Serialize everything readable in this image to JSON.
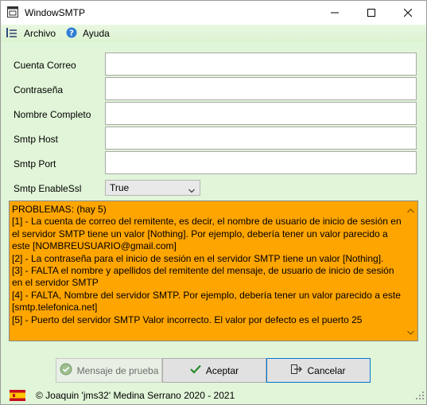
{
  "window": {
    "title": "WindowSMTP",
    "controls": [
      "minimize",
      "maximize",
      "close"
    ]
  },
  "menu": {
    "archivo": "Archivo",
    "ayuda": "Ayuda"
  },
  "form": {
    "cuenta_correo_label": "Cuenta Correo",
    "cuenta_correo_value": "",
    "contrasena_label": "Contraseña",
    "contrasena_value": "",
    "nombre_completo_label": "Nombre Completo",
    "nombre_completo_value": "",
    "smtp_host_label": "Smtp Host",
    "smtp_host_value": "",
    "smtp_port_label": "Smtp Port",
    "smtp_port_value": "",
    "smtp_enablessl_label": "Smtp EnableSsl",
    "smtp_enablessl_selected": "True"
  },
  "problems": {
    "text": "PROBLEMAS: (hay 5)\n[1] - La cuenta de correo del remitente, es decir, el nombre de usuario de inicio de sesión en el servidor SMTP tiene un valor [Nothing]. Por ejemplo, debería tener un valor parecido a este [NOMBREUSUARIO@gmail.com]\n[2] - La contraseña para el inicio de sesión en el servidor SMTP tiene un valor [Nothing].\n[3] - FALTA el nombre y apellidos del remitente del mensaje, de usuario de inicio de sesión en el servidor SMTP\n[4] - FALTA, Nombre del servidor SMTP. Por ejemplo, debería tener un valor parecido a este [smtp.telefonica.net]\n[5] - Puerto del servidor SMTP Valor incorrecto. El valor por defecto es el puerto 25",
    "background": "#ffa500"
  },
  "buttons": {
    "test_label": "Mensaje de prueba",
    "accept_label": "Aceptar",
    "cancel_label": "Cancelar"
  },
  "footer": {
    "copyright": "© Joaquin 'jms32' Medina Serrano 2020 - 2021"
  },
  "colors": {
    "window_background": "#e1f5d8",
    "problems_background": "#ffa500",
    "focus_border": "#0078d7"
  }
}
